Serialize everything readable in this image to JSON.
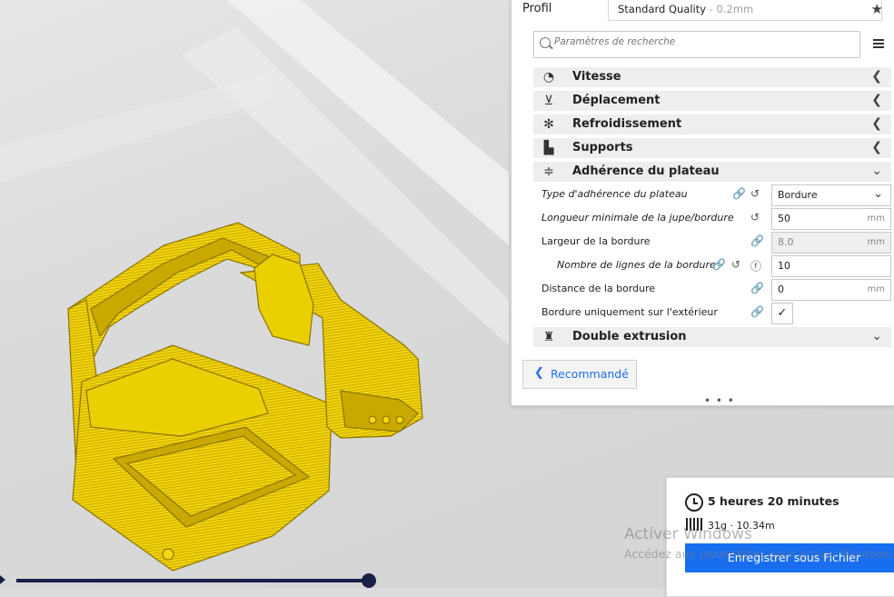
{
  "profile": {
    "label": "Profil",
    "quality": "Standard Quality",
    "layer_height": " - 0.2mm"
  },
  "search": {
    "placeholder": "Paramètres de recherche"
  },
  "categories": {
    "vitesse": "Vitesse",
    "deplacement": "Déplacement",
    "refroidissement": "Refroidissement",
    "supports": "Supports",
    "adherence": "Adhérence du plateau",
    "double_extrusion": "Double extrusion"
  },
  "settings": [
    {
      "label": "Type d'adhérence du plateau",
      "value": "Bordure",
      "unit": ""
    },
    {
      "label": "Longueur minimale de la jupe/bordure",
      "value": "50",
      "unit": "mm"
    },
    {
      "label": "Largeur de la bordure",
      "value": "8.0",
      "unit": "mm"
    },
    {
      "label": "Nombre de lignes de la bordure",
      "value": "10",
      "unit": ""
    },
    {
      "label": "Distance de la bordure",
      "value": "0",
      "unit": "mm"
    },
    {
      "label": "Bordure uniquement sur l'extérieur",
      "checked": true
    }
  ],
  "recommended_button": "Recommandé",
  "print_info": {
    "time": "5 heures 20 minutes",
    "material": "31g · 10.34m",
    "save_button": "Enregistrer sous Fichier"
  },
  "watermark": {
    "line1": "Activer Windows",
    "line2": "Accédez aux paramètres pour activer Windows."
  },
  "colors": {
    "accent": "#196ef0",
    "model": "#f5d60a",
    "slider": "#1a2148"
  }
}
